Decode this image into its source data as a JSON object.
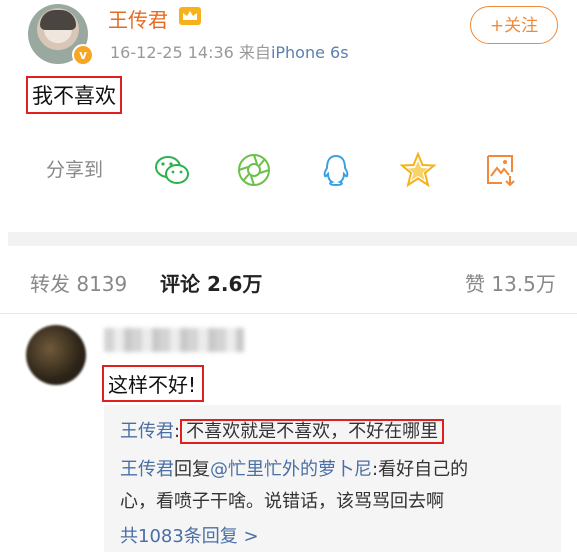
{
  "post": {
    "username": "王传君",
    "crown_icon": "crown-icon",
    "timestamp": "16-12-25 14:36",
    "source_prefix": "来自",
    "source": "iPhone 6s",
    "follow_label": "+关注",
    "text": "我不喜欢"
  },
  "share": {
    "label": "分享到",
    "icons": [
      "wechat-icon",
      "moments-icon",
      "qq-icon",
      "favorite-star-icon",
      "save-image-icon"
    ]
  },
  "tabs": {
    "repost_label": "转发",
    "repost_count": "8139",
    "comment_label": "评论",
    "comment_count": "2.6万",
    "like_label": "赞",
    "like_count": "13.5万"
  },
  "comment": {
    "text": "这样不好!",
    "replies": [
      {
        "author": "王传君",
        "sep": ":",
        "text": "不喜欢就是不喜欢，不好在哪里"
      },
      {
        "author": "王传君",
        "mid": "回复",
        "mention": "@忙里忙外的萝卜尼",
        "text1": ":看好自己的",
        "text2": "心，看喷子干啥。说错话，该骂骂回去啊"
      }
    ],
    "more_replies": "共1083条回复 >"
  },
  "colors": {
    "accent": "#f08a3a",
    "link": "#4a6fa5",
    "highlight_box": "#e02020"
  }
}
